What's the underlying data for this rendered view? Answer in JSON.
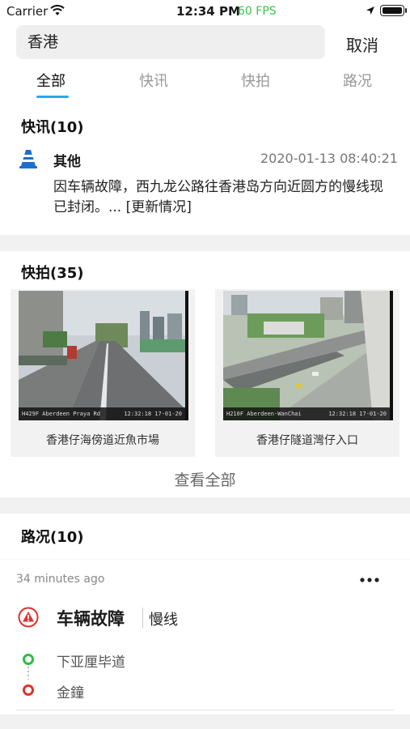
{
  "status_bar": {
    "carrier": "Carrier",
    "time": "12:34 PM",
    "fps": "60 FPS"
  },
  "search": {
    "query": "香港",
    "cancel_label": "取消"
  },
  "tabs": [
    {
      "label": "全部",
      "active": true
    },
    {
      "label": "快讯",
      "active": false
    },
    {
      "label": "快拍",
      "active": false
    },
    {
      "label": "路况",
      "active": false
    }
  ],
  "news": {
    "title": "快讯(10)",
    "item": {
      "icon": "traffic-cone-icon",
      "category": "其他",
      "time": "2020-01-13 08:40:21",
      "body": "因车辆故障，西九龙公路往香港岛方向近圆方的慢线现已封闭。... [更新情况]"
    }
  },
  "snapshots": {
    "title": "快拍(35)",
    "cameras": [
      {
        "caption": "香港仔海傍道近魚市場",
        "overlay": "H429F Aberdeen Praya Rd",
        "stamp": "12:32:18 17-01-20"
      },
      {
        "caption": "香港仔隧道灣仔入口",
        "overlay": "H210F Aberdeen-WanChai",
        "stamp": "12:32:18 17-01-20"
      }
    ],
    "view_all_label": "查看全部"
  },
  "traffic": {
    "title": "路况(10)",
    "item": {
      "ago": "34 minutes ago",
      "event": "车辆故障",
      "lane": "慢线",
      "from": "下亚厘毕道",
      "to": "金鐘"
    }
  },
  "colors": {
    "accent": "#2aa8e8",
    "from_dot": "#2bbf3f",
    "to_dot": "#e0312f",
    "warn": "#e0312f",
    "cone": "#1c6fd1",
    "fps": "#3ec24a"
  }
}
